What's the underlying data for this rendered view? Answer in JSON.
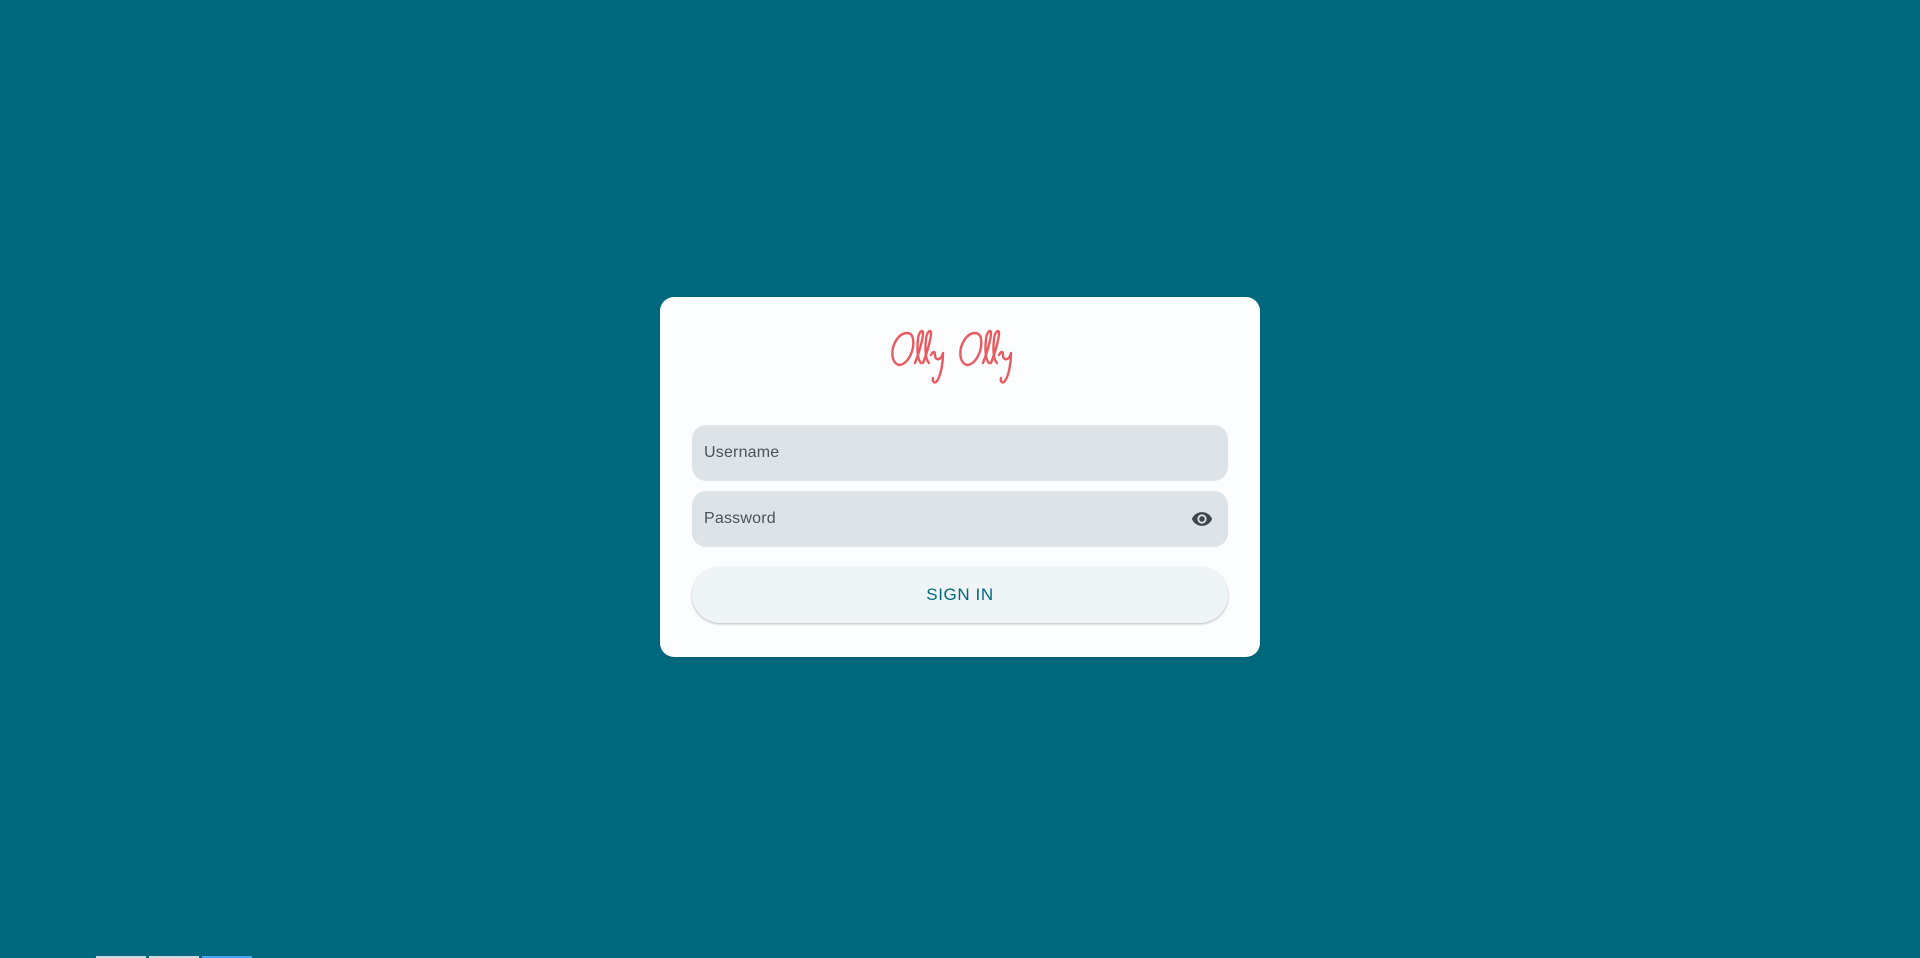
{
  "colors": {
    "background": "#00687d",
    "logo": "#e85a5f",
    "field_fill": "#dde3e6",
    "button_text": "#00687d",
    "icon": "#3f4648"
  },
  "logo": {
    "text": "Olly Olly"
  },
  "form": {
    "username": {
      "placeholder": "Username",
      "value": ""
    },
    "password": {
      "placeholder": "Password",
      "value": "",
      "visibility_icon": "eye-icon"
    },
    "submit_label": "SIGN IN"
  }
}
